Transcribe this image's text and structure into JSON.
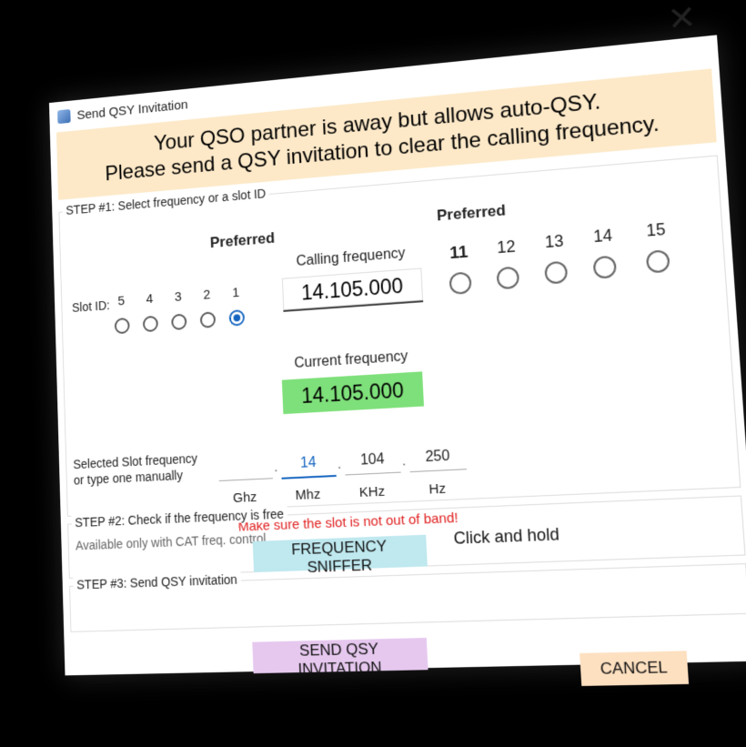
{
  "window": {
    "title": "Send QSY Invitation",
    "close_glyph": "✕"
  },
  "banner": {
    "line1": "Your QSO partner is away but allows auto-QSY.",
    "line2": "Please send a QSY invitation to clear the calling frequency."
  },
  "step1": {
    "label": "STEP #1: Select frequency or a slot ID",
    "slot_id_label": "Slot ID:",
    "left_slots": [
      "5",
      "4",
      "3",
      "2",
      "1"
    ],
    "left_selected": "1",
    "preferred_left": "Preferred",
    "calling_caption": "Calling frequency",
    "calling_value": "14.105.000",
    "preferred_right": "Preferred",
    "right_slots": [
      "11",
      "12",
      "13",
      "14",
      "15"
    ],
    "current_caption": "Current frequency",
    "current_value": "14.105.000",
    "selected_label_1": "Selected Slot frequency",
    "selected_label_2": "or type one manually",
    "inputs": {
      "ghz": "",
      "mhz": "14",
      "khz": "104",
      "hz": "250"
    },
    "units": {
      "ghz": "Ghz",
      "mhz": "Mhz",
      "khz": "KHz",
      "hz": "Hz"
    },
    "separator": ".",
    "warning": "Make sure the slot is not out of band!"
  },
  "step2": {
    "label": "STEP #2: Check if the frequency is free",
    "note": "Available only with CAT freq. control",
    "sniffer_button": "FREQUENCY SNIFFER",
    "hint": "Click and hold"
  },
  "step3": {
    "label": "STEP #3: Send QSY invitation",
    "send_button": "SEND QSY INVITATION"
  },
  "footer": {
    "cancel_button": "CANCEL"
  },
  "colors": {
    "banner": "#fde9c8",
    "current_freq": "#7ee07a",
    "sniffer": "#bfe8ef",
    "send": "#e6c8ef",
    "cancel": "#fde0c0",
    "warning": "#e02020",
    "radio_selected": "#1565c0"
  }
}
